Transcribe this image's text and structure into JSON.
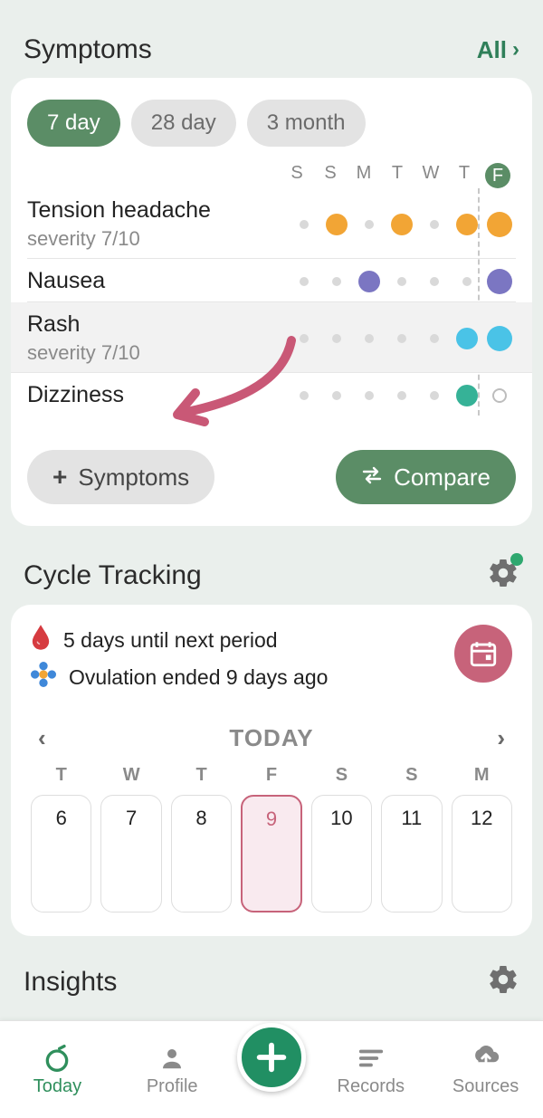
{
  "symptoms": {
    "title": "Symptoms",
    "all_label": "All",
    "ranges": {
      "r7": "7 day",
      "r28": "28 day",
      "r3m": "3 month"
    },
    "day_headers": [
      "S",
      "S",
      "M",
      "T",
      "W",
      "T",
      "F"
    ],
    "rows": {
      "tension": {
        "name": "Tension headache",
        "severity": "severity 7/10"
      },
      "nausea": {
        "name": "Nausea"
      },
      "rash": {
        "name": "Rash",
        "severity": "severity 7/10"
      },
      "dizz": {
        "name": "Dizziness"
      }
    },
    "add_label": "Symptoms",
    "compare_label": "Compare"
  },
  "cycle": {
    "title": "Cycle Tracking",
    "period_line": "5 days until next period",
    "ovulation_line": "Ovulation ended 9 days ago",
    "today_label": "TODAY",
    "days": {
      "dow": [
        "T",
        "W",
        "T",
        "F",
        "S",
        "S",
        "M"
      ],
      "num": [
        "6",
        "7",
        "8",
        "9",
        "10",
        "11",
        "12"
      ]
    }
  },
  "insights": {
    "title": "Insights"
  },
  "nav": {
    "today": "Today",
    "profile": "Profile",
    "records": "Records",
    "sources": "Sources"
  },
  "chart_data": {
    "type": "table",
    "title": "7-day symptom occurrence grid",
    "columns": [
      "S",
      "S",
      "M",
      "T",
      "W",
      "T",
      "F"
    ],
    "legend": {
      "none": "no entry (small grey placeholder)",
      "orange": "Tension headache logged",
      "purple": "Nausea logged",
      "blue": "Rash logged",
      "teal": "Dizziness logged",
      "ring": "empty outlined marker"
    },
    "series": [
      {
        "name": "Tension headache",
        "values": [
          "none",
          "orange",
          "none",
          "orange",
          "none",
          "orange",
          "orange"
        ]
      },
      {
        "name": "Nausea",
        "values": [
          "none",
          "none",
          "purple",
          "none",
          "none",
          "none",
          "purple"
        ]
      },
      {
        "name": "Rash",
        "values": [
          "none",
          "none",
          "none",
          "none",
          "none",
          "blue",
          "blue"
        ]
      },
      {
        "name": "Dizziness",
        "values": [
          "none",
          "none",
          "none",
          "none",
          "none",
          "teal",
          "ring"
        ]
      }
    ]
  }
}
